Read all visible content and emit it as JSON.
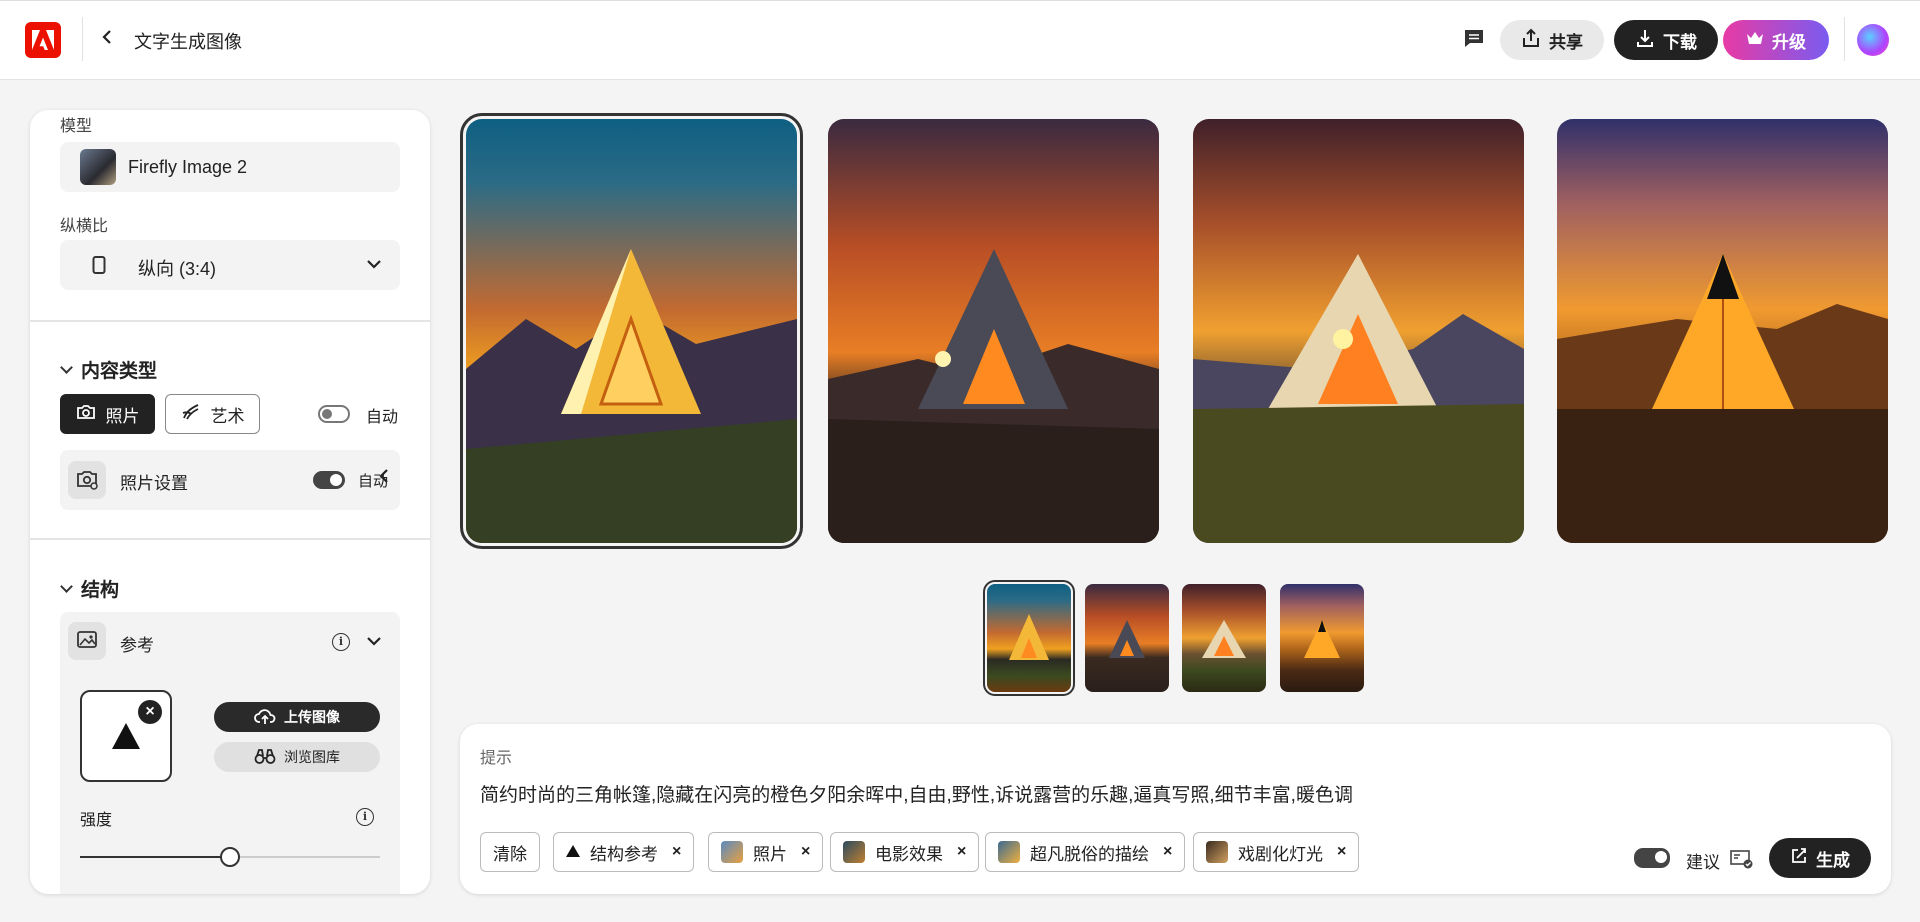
{
  "header": {
    "title": "文字生成图像",
    "share_label": "共享",
    "download_label": "下载",
    "upgrade_label": "升级"
  },
  "sidebar": {
    "model_label": "模型",
    "model_value": "Firefly Image 2",
    "aspect_label": "纵横比",
    "aspect_value": "纵向 (3:4)",
    "content_type_heading": "内容类型",
    "photo_label": "照片",
    "art_label": "艺术",
    "auto_label": "自动",
    "photo_settings_label": "照片设置",
    "photo_settings_auto": "自动",
    "structure_heading": "结构",
    "reference_label": "参考",
    "upload_label": "上传图像",
    "browse_label": "浏览图库",
    "strength_label": "强度",
    "strength_value": 0.5
  },
  "gallery": {
    "selected_index": 0,
    "image_count": 4
  },
  "prompt": {
    "label": "提示",
    "text": "简约时尚的三角帐篷,隐藏在闪亮的橙色夕阳余晖中,自由,野性,诉说露营的乐趣,逼真写照,细节丰富,暖色调",
    "clear_label": "清除",
    "chips": [
      {
        "label": "结构参考"
      },
      {
        "label": "照片"
      },
      {
        "label": "电影效果"
      },
      {
        "label": "超凡脱俗的描绘"
      },
      {
        "label": "戏剧化灯光"
      }
    ],
    "suggest_label": "建议",
    "generate_label": "生成"
  },
  "colors": {
    "brand": "#eb1000",
    "upgrade_start": "#e83aa4",
    "upgrade_end": "#7a5cf0"
  }
}
